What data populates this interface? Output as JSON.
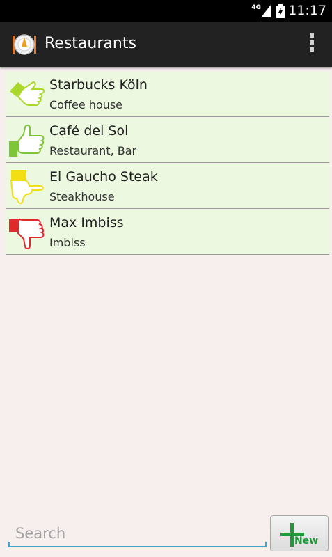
{
  "status_bar": {
    "network": "4G",
    "time": "11:17"
  },
  "action_bar": {
    "title": "Restaurants"
  },
  "restaurants": [
    {
      "name": "Starbucks Köln",
      "kind": "Coffee house",
      "rating_icon": "thumb-sideways-up-icon",
      "color": "#a9d82a"
    },
    {
      "name": "Café del Sol",
      "kind": "Restaurant, Bar",
      "rating_icon": "thumb-up-icon",
      "color": "#7dc63a"
    },
    {
      "name": "El Gaucho Steak",
      "kind": "Steakhouse",
      "rating_icon": "thumb-sideways-down-icon",
      "color": "#f2de12"
    },
    {
      "name": "Max Imbiss",
      "kind": "Imbiss",
      "rating_icon": "thumb-down-icon",
      "color": "#e02a2a"
    }
  ],
  "search": {
    "placeholder": "Search",
    "value": ""
  },
  "new_button": {
    "label": "New"
  },
  "colors": {
    "accent": "#3aa7d3",
    "new_green": "#1e9a3a",
    "row_bg": "#ecf8e0",
    "page_bg": "#f7eeee"
  }
}
